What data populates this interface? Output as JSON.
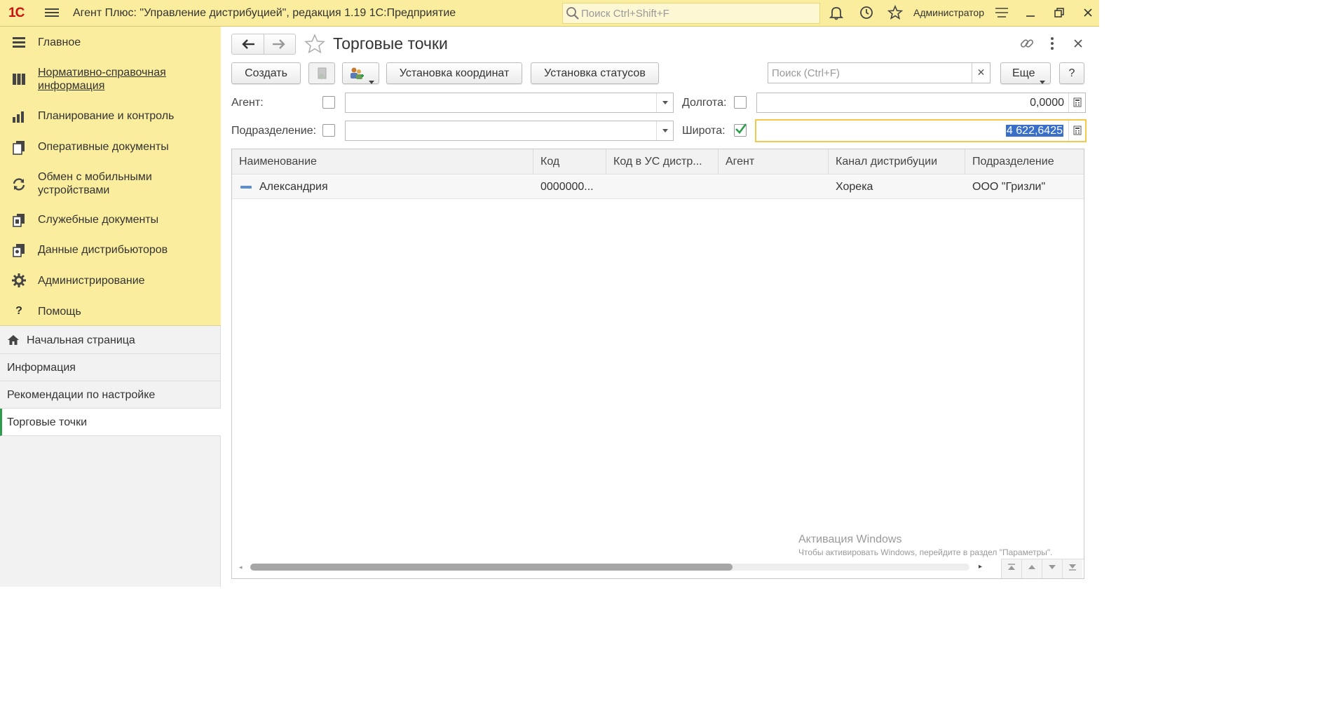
{
  "app": {
    "logo": "1С",
    "title": "Агент Плюс: \"Управление дистрибуцией\", редакция 1.19 1С:Предприятие",
    "search_placeholder": "Поиск Ctrl+Shift+F",
    "user": "Администратор"
  },
  "sections": [
    {
      "label": "Главное",
      "icon": "menu-list-icon"
    },
    {
      "label": "Нормативно-справочная информация",
      "icon": "catalog-icon"
    },
    {
      "label": "Планирование и контроль",
      "icon": "bar-chart-icon"
    },
    {
      "label": "Оперативные документы",
      "icon": "documents-icon"
    },
    {
      "label": "Обмен с мобильными устройствами",
      "icon": "sync-icon"
    },
    {
      "label": "Служебные документы",
      "icon": "service-docs-icon"
    },
    {
      "label": "Данные дистрибьюторов",
      "icon": "distributor-data-icon"
    },
    {
      "label": "Администрирование",
      "icon": "gear-icon"
    },
    {
      "label": "Помощь",
      "icon": "help-icon"
    }
  ],
  "open_windows": [
    {
      "label": "Начальная страница",
      "icon": "home-icon"
    },
    {
      "label": "Информация"
    },
    {
      "label": "Рекомендации по настройке"
    },
    {
      "label": "Торговые точки",
      "active": true
    }
  ],
  "form": {
    "title": "Торговые точки",
    "buttons": {
      "create": "Создать",
      "set_coordinates": "Установка координат",
      "set_statuses": "Установка статусов",
      "more": "Еще",
      "help": "?"
    },
    "search_placeholder": "Поиск (Ctrl+F)",
    "filters": {
      "agent_label": "Агент:",
      "agent_checked": false,
      "agent_value": "",
      "division_label": "Подразделение:",
      "division_checked": false,
      "division_value": "",
      "longitude_label": "Долгота:",
      "longitude_checked": false,
      "longitude_value": "0,0000",
      "latitude_label": "Широта:",
      "latitude_checked": true,
      "latitude_value": "4 622,6425"
    },
    "table": {
      "columns": [
        "Наименование",
        "Код",
        "Код в УС дистр...",
        "Агент",
        "Канал дистрибуции",
        "Подразделение"
      ],
      "rows": [
        [
          "Александрия",
          "0000000...",
          "",
          "",
          "Хорека",
          "ООО \"Гризли\""
        ]
      ]
    },
    "watermark": {
      "line1": "Активация Windows",
      "line2": "Чтобы активировать Windows, перейдите в раздел \"Параметры\"."
    }
  },
  "colors": {
    "accent_yellow": "#fbed9e",
    "active_green": "#2e9d4b",
    "selection_blue": "#3a6fc9",
    "focus_border": "#f2c94c"
  }
}
